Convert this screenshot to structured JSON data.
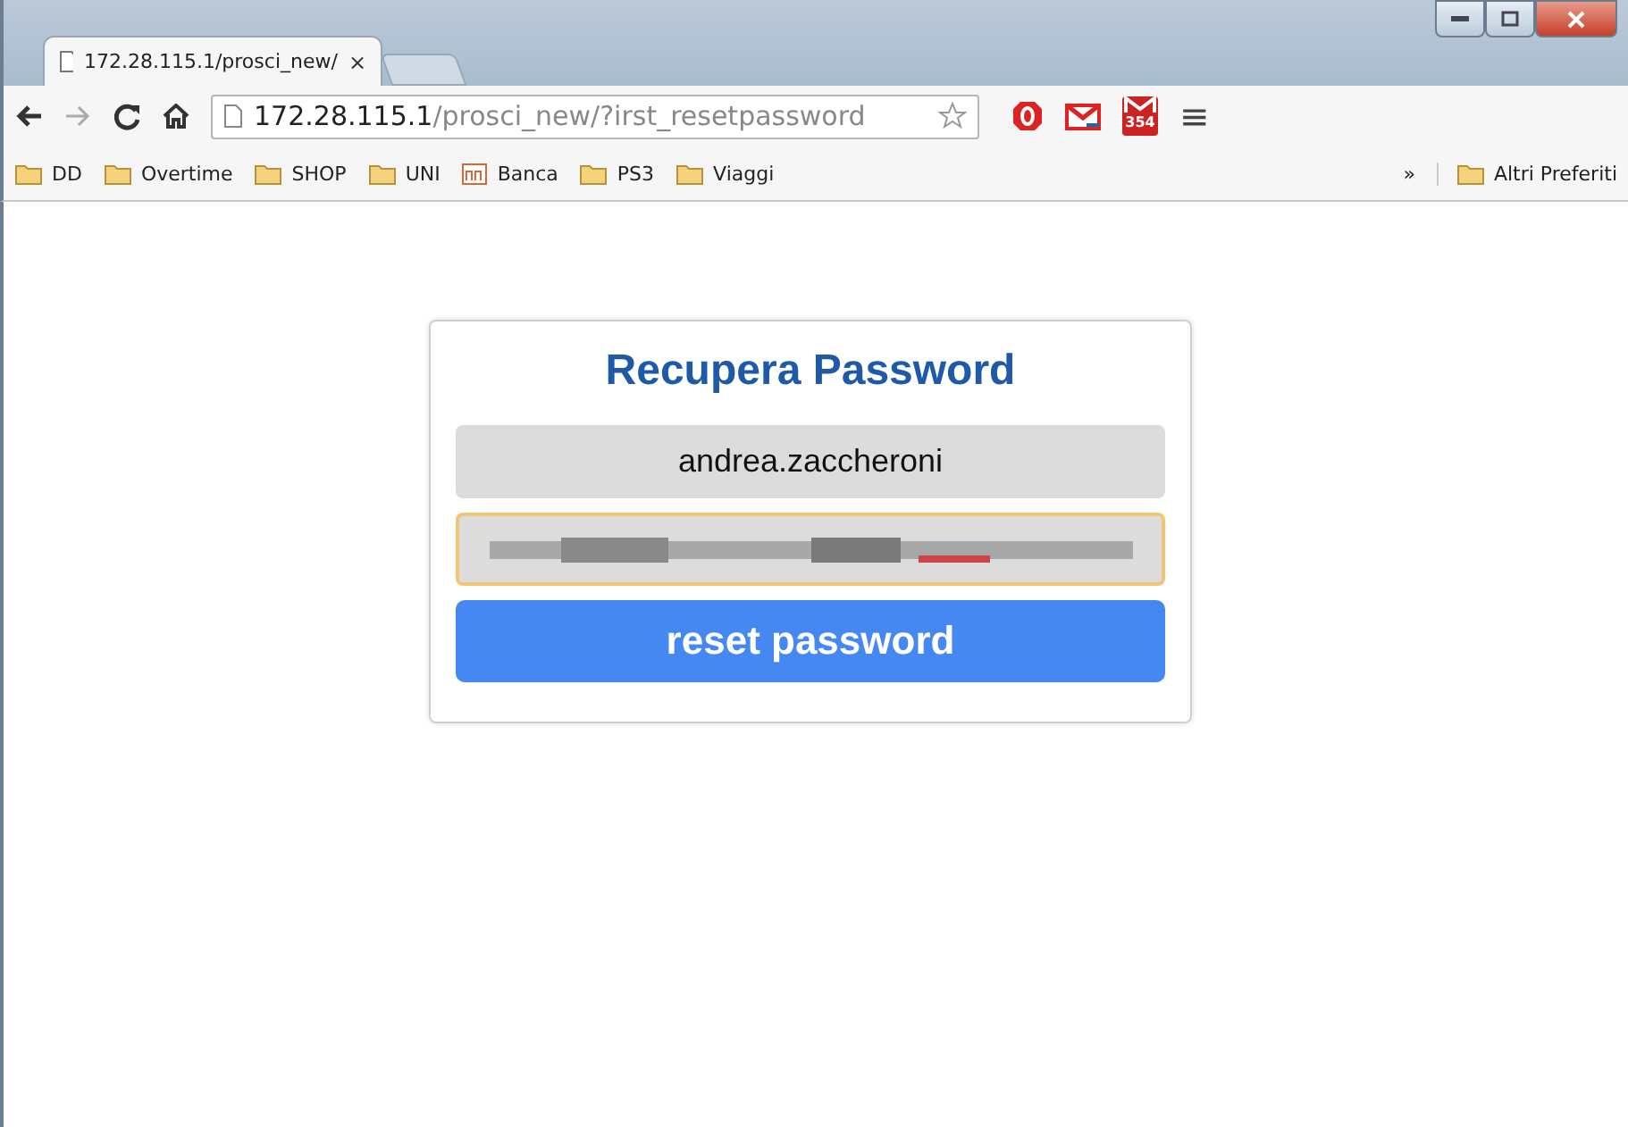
{
  "browser": {
    "tab": {
      "title": "172.28.115.1/prosci_new/",
      "close": "×"
    },
    "url": {
      "host": "172.28.115.1",
      "path": "/prosci_new/?irst_resetpassword"
    },
    "extension_badge": "354",
    "menu": "≡",
    "bookmarks": [
      {
        "label": "DD",
        "kind": "folder"
      },
      {
        "label": "Overtime",
        "kind": "folder"
      },
      {
        "label": "SHOP",
        "kind": "folder"
      },
      {
        "label": "UNI",
        "kind": "folder"
      },
      {
        "label": "Banca",
        "kind": "site"
      },
      {
        "label": "PS3",
        "kind": "folder"
      },
      {
        "label": "Viaggi",
        "kind": "folder"
      }
    ],
    "more": "»",
    "other_bookmarks": "Altri Preferiti"
  },
  "form": {
    "title": "Recupera Password",
    "username": "andrea.zaccheroni",
    "email_focused": true,
    "button": "reset password"
  }
}
